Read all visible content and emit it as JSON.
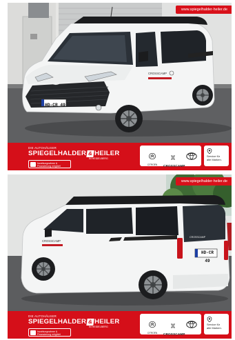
{
  "panels": [
    {
      "id": "front",
      "url": "www.spiegelhalder-heiler.de",
      "plate": "HD-CR 49",
      "van_side_text": "CROSSCAMP",
      "banner": {
        "brand_top": "DIE AUTOHÄUSER",
        "brand_left": "SPIEGELHALDER",
        "brand_amp": "&",
        "brand_right": "HEILER",
        "brand_sub": "IN HEIDELBERG",
        "finance_line1": "Inzahlungnahme &",
        "finance_line2": "Finanzierung möglich!",
        "citroen_caption": "CITROËN",
        "crosscamp_label": "CROSSCAMP",
        "service_line1": "Service für",
        "service_line2": "alle Marken."
      }
    },
    {
      "id": "rear",
      "url": "www.spiegelhalder-heiler.de",
      "plate": "HD-CR 49",
      "van_side_text": "CROSSCAMP",
      "banner": {
        "brand_top": "DIE AUTOHÄUSER",
        "brand_left": "SPIEGELHALDER",
        "brand_amp": "&",
        "brand_right": "HEILER",
        "brand_sub": "IN HEIDELBERG",
        "finance_line1": "Inzahlungnahme &",
        "finance_line2": "Finanzierung möglich!",
        "citroen_caption": "CITROËN",
        "crosscamp_label": "CROSSCAMP",
        "service_line1": "Service für",
        "service_line2": "alle Marken."
      }
    }
  ],
  "colors": {
    "banner_red": "#d50f19",
    "van_white": "#f4f5f5",
    "roof_black": "#1b1c1e",
    "asphalt": "#5d5e60"
  },
  "icons": [
    "citroen-logo-icon",
    "crosscamp-logo-icon",
    "toyota-logo-icon",
    "service-pin-icon",
    "finance-card-icon"
  ]
}
